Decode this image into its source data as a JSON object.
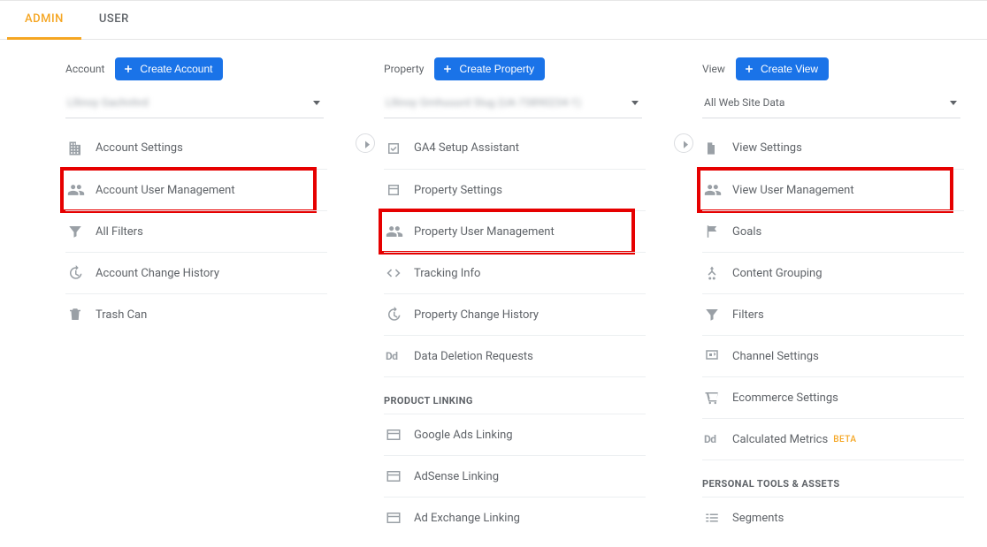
{
  "tabs": {
    "admin": "ADMIN",
    "user": "USER"
  },
  "columns": {
    "account": {
      "label": "Account",
      "button": "Create Account",
      "selected": "Lllinoy Gachnhrd",
      "items": [
        {
          "label": "Account Settings"
        },
        {
          "label": "Account User Management"
        },
        {
          "label": "All Filters"
        },
        {
          "label": "Account Change History"
        },
        {
          "label": "Trash Can"
        }
      ]
    },
    "property": {
      "label": "Property",
      "button": "Create Property",
      "selected": "Lllinoy Gmhuuurd Slug (UA-73890234-1)",
      "section1": "PRODUCT LINKING",
      "items": [
        {
          "label": "GA4 Setup Assistant"
        },
        {
          "label": "Property Settings"
        },
        {
          "label": "Property User Management"
        },
        {
          "label": "Tracking Info"
        },
        {
          "label": "Property Change History"
        },
        {
          "label": "Data Deletion Requests"
        },
        {
          "label": "Google Ads Linking"
        },
        {
          "label": "AdSense Linking"
        },
        {
          "label": "Ad Exchange Linking"
        }
      ]
    },
    "view": {
      "label": "View",
      "button": "Create View",
      "selected": "All Web Site Data",
      "section1": "PERSONAL TOOLS & ASSETS",
      "beta": "BETA",
      "items": [
        {
          "label": "View Settings"
        },
        {
          "label": "View User Management"
        },
        {
          "label": "Goals"
        },
        {
          "label": "Content Grouping"
        },
        {
          "label": "Filters"
        },
        {
          "label": "Channel Settings"
        },
        {
          "label": "Ecommerce Settings"
        },
        {
          "label": "Calculated Metrics"
        },
        {
          "label": "Segments"
        }
      ]
    }
  }
}
